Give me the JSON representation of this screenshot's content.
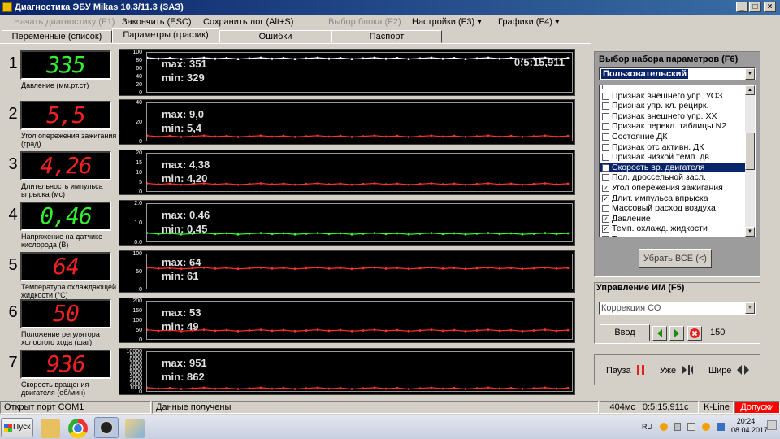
{
  "window": {
    "title": "Диагностика ЭБУ Mikas 10.3/11.3 (ЗАЗ)"
  },
  "menu": [
    {
      "label": "Начать диагностику (F1)",
      "enabled": false
    },
    {
      "label": "Закончить (ESC)",
      "enabled": true
    },
    {
      "label": "Сохранить лог (Alt+S)",
      "enabled": true
    },
    {
      "label": "Выбор блока (F2)",
      "enabled": false
    },
    {
      "label": "Настройки (F3) ▾",
      "enabled": true
    },
    {
      "label": "Графики (F4) ▾",
      "enabled": true
    }
  ],
  "tabs": [
    {
      "label": "Переменные (список)",
      "active": false
    },
    {
      "label": "Параметры (график)",
      "active": true
    },
    {
      "label": "Ошибки",
      "active": false
    },
    {
      "label": "Паспорт",
      "active": false
    }
  ],
  "timer": "0:5:15,911",
  "rows": [
    {
      "num": "1",
      "value": "335",
      "color": "green",
      "label": "Давление (мм.рт.ст)",
      "max": "max: 351",
      "min": "min: 329",
      "yticks": [
        "100",
        "80",
        "60",
        "40",
        "20",
        "0"
      ],
      "level": 0.88,
      "trace": "#ffffff"
    },
    {
      "num": "2",
      "value": "5,5",
      "color": "red",
      "label": "Угол опережения зажигания (град)",
      "max": "max: 9,0",
      "min": "min: 5,4",
      "yticks": [
        "40",
        "20",
        "0"
      ],
      "level": 0.14,
      "trace": "#ff3030"
    },
    {
      "num": "3",
      "value": "4,26",
      "color": "red",
      "label": "Длительность импульса впрыска (мс)",
      "max": "max: 4,38",
      "min": "min: 4,20",
      "yticks": [
        "20",
        "15",
        "10",
        "5",
        "0"
      ],
      "level": 0.21,
      "trace": "#ff3030"
    },
    {
      "num": "4",
      "value": "0,46",
      "color": "green",
      "label": "Напряжение на датчике кислорода (В)",
      "max": "max: 0,46",
      "min": "min: 0,45",
      "yticks": [
        "2.0",
        "1.0",
        "0.0"
      ],
      "level": 0.23,
      "trace": "#30ff30"
    },
    {
      "num": "5",
      "value": "64",
      "color": "red",
      "label": "Температура охлаждающей жидкости (°С)",
      "max": "max: 64",
      "min": "min: 61",
      "yticks": [
        "100",
        "50",
        "0"
      ],
      "level": 0.62,
      "trace": "#ff3030"
    },
    {
      "num": "6",
      "value": "50",
      "color": "red",
      "label": "Положение регулятора холостого хода (шаг)",
      "max": "max: 53",
      "min": "min: 49",
      "yticks": [
        "200",
        "150",
        "100",
        "50",
        "0"
      ],
      "level": 0.25,
      "trace": "#ff3030"
    },
    {
      "num": "7",
      "value": "936",
      "color": "red",
      "label": "Скорость вращения двигателя (об/мин)",
      "max": "max: 951",
      "min": "min: 862",
      "yticks": [
        "10000",
        "9000",
        "8000",
        "7000",
        "6000",
        "5000",
        "4000",
        "3000",
        "2000",
        "1000",
        "0"
      ],
      "level": 0.09,
      "trace": "#ff3030"
    }
  ],
  "param_panel": {
    "title": "Выбор набора параметров (F6)",
    "preset": "Пользовательский",
    "items": [
      {
        "label": "",
        "checked": false
      },
      {
        "label": "Признак внешнего упр. УОЗ",
        "checked": false
      },
      {
        "label": "Признак упр. кл. рецирк.",
        "checked": false
      },
      {
        "label": "Признак внешнего упр. ХХ",
        "checked": false
      },
      {
        "label": "Признак перекл. таблицы N2",
        "checked": false
      },
      {
        "label": "Состояние ДК",
        "checked": false
      },
      {
        "label": "Признак отс активн. ДК",
        "checked": false
      },
      {
        "label": "Признак низкой темп. дв.",
        "checked": false
      },
      {
        "label": "Скорость вр. двигателя",
        "checked": true,
        "selected": true
      },
      {
        "label": "Пол. дроссельной засл.",
        "checked": false
      },
      {
        "label": "Угол опережения зажигания",
        "checked": true
      },
      {
        "label": "Длит. импульса впрыска",
        "checked": true
      },
      {
        "label": "Массовый расход воздуха",
        "checked": false
      },
      {
        "label": "Давление",
        "checked": true
      },
      {
        "label": "Темп. охлажд. жидкости",
        "checked": true
      },
      {
        "label": "Температура воздуха",
        "checked": false
      }
    ],
    "clear_button": "Убрать ВСЕ (<)"
  },
  "control_panel": {
    "title": "Управление ИМ (F5)",
    "selected": "Коррекция СО",
    "input_button": "Ввод",
    "value": "150"
  },
  "playback": {
    "pause": "Пауза",
    "narrower": "Уже",
    "wider": "Шире"
  },
  "status": {
    "port": "Открыт порт COM1",
    "data": "Данные получены",
    "timing": "404мс | 0:5:15,911с",
    "protocol": "K-Line",
    "alert": "Допуски"
  },
  "taskbar": {
    "start": "Пуск",
    "lang": "RU",
    "time": "20:24",
    "date": "08.04.2017"
  },
  "colors": {
    "title_bar": "#0a246a",
    "lcd_green": "#33ee33",
    "lcd_red": "#ee2222",
    "alert": "#ff0000"
  }
}
